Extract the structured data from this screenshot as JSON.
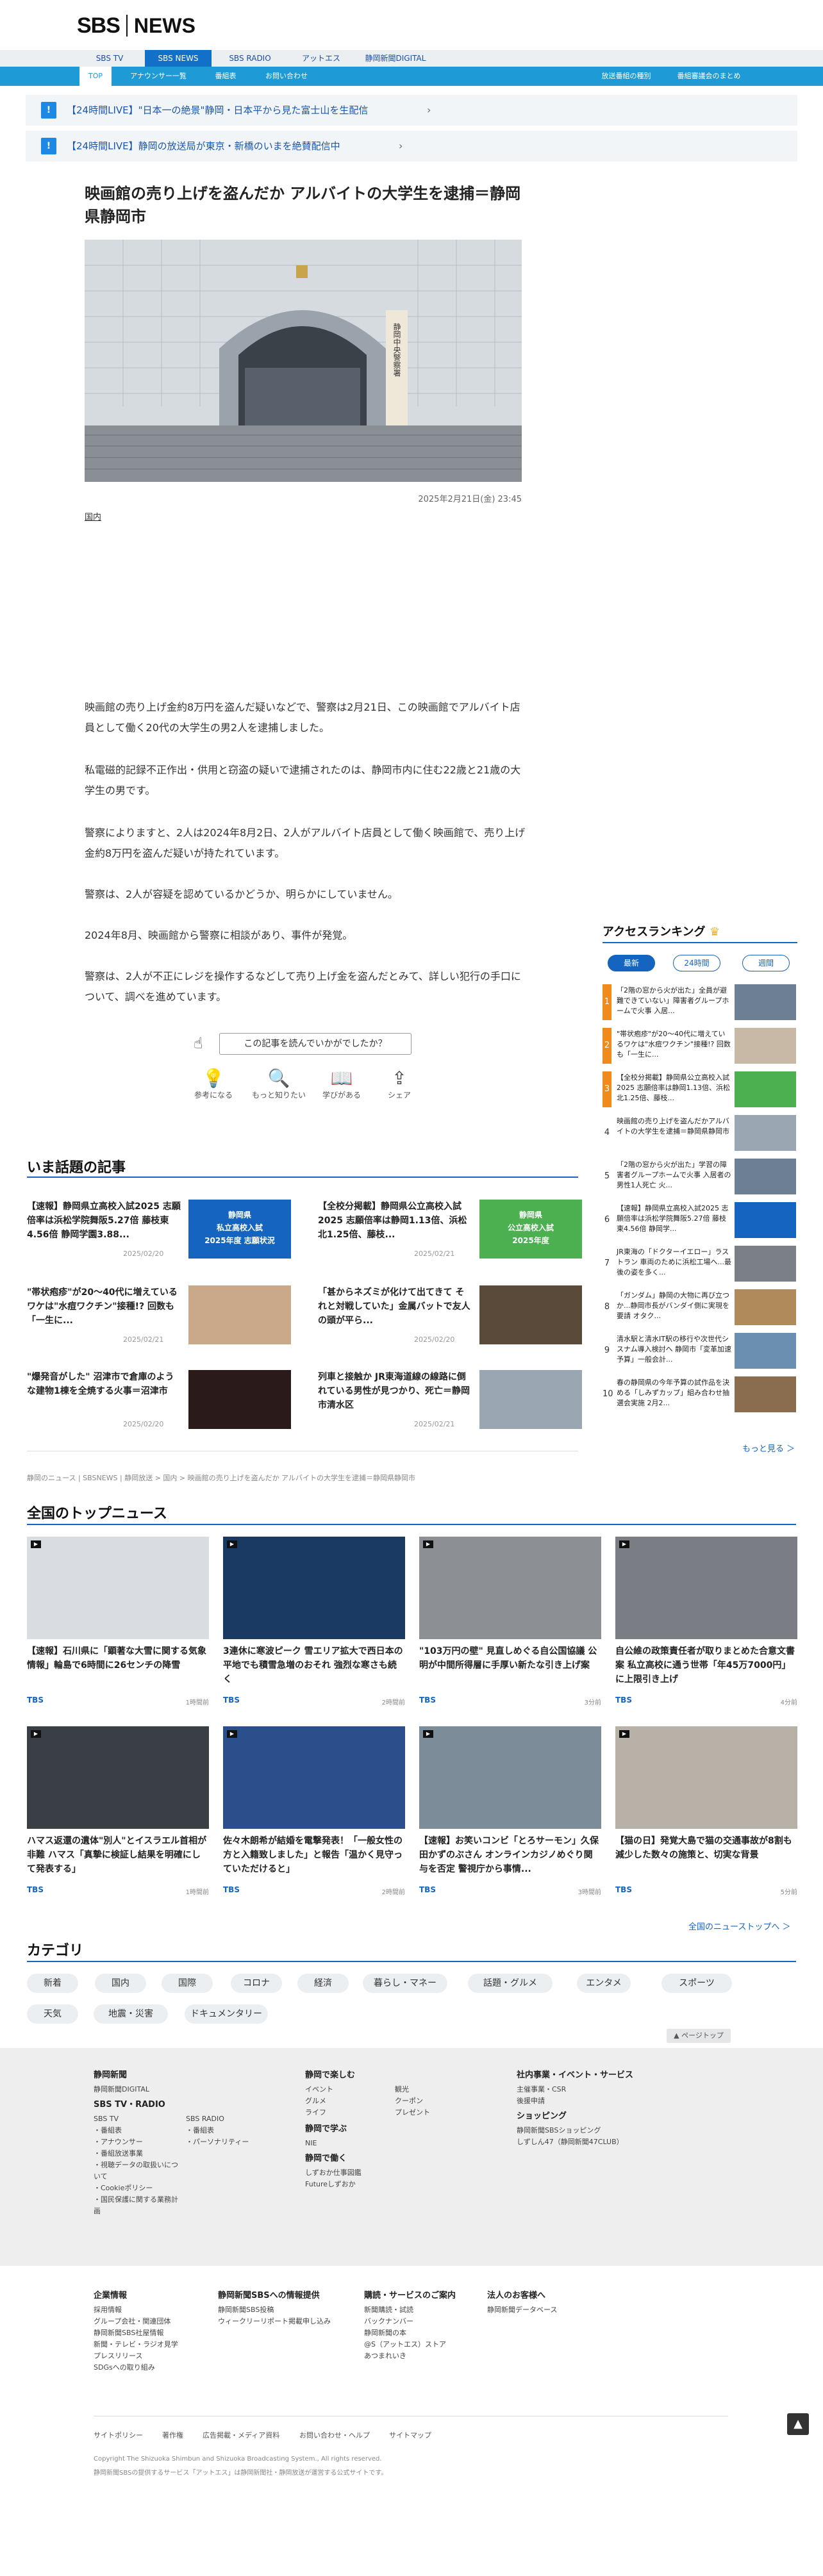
{
  "header": {
    "logo_sbs": "SBS",
    "logo_news": "NEWS",
    "nav1": [
      "SBS TV",
      "SBS NEWS",
      "SBS RADIO",
      "アットエス",
      "静岡新聞DIGITAL"
    ],
    "nav2_left": [
      "TOP",
      "アナウンサー一覧",
      "番組表",
      "お問い合わせ"
    ],
    "nav2_right": [
      "放送番組の種別",
      "番組審議会のまとめ"
    ]
  },
  "live_banners": [
    {
      "icon": "!",
      "text": "【24時間LIVE】\"日本一の絶景\"静岡・日本平から見た富士山を生配信"
    },
    {
      "icon": "!",
      "text": "【24時間LIVE】静岡の放送局が東京・新橋のいまを絶賛配信中"
    }
  ],
  "article": {
    "title": "映画館の売り上げを盗んだか アルバイトの大学生を逮捕＝静岡県静岡市",
    "photo_text": "静岡中央警察署",
    "date": "2025年2月21日(金) 23:45",
    "tag": "国内",
    "paragraphs": [
      "映画館の売り上げ金約8万円を盗んだ疑いなどで、警察は2月21日、この映画館でアルバイト店員として働く20代の大学生の男2人を逮捕しました。",
      "私電磁的記録不正作出・供用と窃盗の疑いで逮捕されたのは、静岡市内に住む22歳と21歳の大学生の男です。",
      "警察によりますと、2人は2024年8月2日、2人がアルバイト店員として働く映画館で、売り上げ金約8万円を盗んだ疑いが持たれています。",
      "警察は、2人が容疑を認めているかどうか、明らかにしていません。",
      "2024年8月、映画館から警察に相談があり、事件が発覚。",
      "警察は、2人が不正にレジを操作するなどして売り上げ金を盗んだとみて、詳しい犯行の手口について、調べを進めています。"
    ],
    "feedback_question": "この記事を読んでいかがでしたか？",
    "reactions": [
      "参考になる",
      "もっと知りたい",
      "学びがある",
      "シェア"
    ]
  },
  "hot_topics": {
    "heading": "いま話題の記事",
    "items": [
      {
        "title": "【速報】静岡県立高校入試2025 志願倍率は浜松学院舞阪5.27倍 藤枝東4.56倍 静岡学園3.88...",
        "date": "2025/02/20",
        "img_label": "静岡県\n私立高校入試\n2025年度 志願状況"
      },
      {
        "title": "【全校分掲載】静岡県公立高校入試2025 志願倍率は静岡1.13倍、浜松北1.25倍、藤枝...",
        "date": "2025/02/21",
        "img_label": "静岡県\n公立高校入試\n2025年度"
      },
      {
        "title": "\"帯状疱疹\"が20〜40代に増えているワケは\"水痘ワクチン\"接種!? 回数も「一生に...",
        "date": "2025/02/21",
        "img_label": ""
      },
      {
        "title": "「甚からネズミが化けて出てきて それと対戦していた」金属バットで友人の頭が平ら...",
        "date": "2025/02/20",
        "img_label": ""
      },
      {
        "title": "\"爆発音がした\" 沼津市で倉庫のような建物1棟を全焼する火事＝沼津市",
        "date": "2025/02/20",
        "img_label": ""
      },
      {
        "title": "列車と接触か JR東海道線の線路に倒れている男性が見つかり、死亡＝静岡市清水区",
        "date": "2025/02/21",
        "img_label": ""
      }
    ]
  },
  "breadcrumb": "静岡のニュース | SBSNEWS | 静岡放送 > 国内 > 映画館の売り上げを盗んだか アルバイトの大学生を逮捕＝静岡県静岡市",
  "ranking": {
    "heading": "アクセスランキング",
    "tabs": [
      "最新",
      "24時間",
      "週間"
    ],
    "items": [
      {
        "rank": "1",
        "title": "「2階の窓から火が出た」全員が避難できていない」障害者グループホームで火事 入居..."
      },
      {
        "rank": "2",
        "title": "\"帯状疱疹\"が20〜40代に増えているワケは\"水痘ワクチン\"接種!? 回数も「一生に..."
      },
      {
        "rank": "3",
        "title": "【全校分掲載】静岡県公立高校入試2025 志願倍率は静岡1.13倍、浜松北1.25倍、藤枝..."
      },
      {
        "rank": "4",
        "title": "映画館の売り上げを盗んだかアルバイトの大学生を逮捕＝静岡県静岡市"
      },
      {
        "rank": "5",
        "title": "「2階の窓から火が出た」学習の障害者グループホームで火事 入居者の男性1人死亡 火..."
      },
      {
        "rank": "6",
        "title": "【速報】静岡県立高校入試2025 志願倍率は浜松学院舞阪5.27倍 藤枝東4.56倍 静岡学..."
      },
      {
        "rank": "7",
        "title": "JR東海の「ドクターイエロー」ラストラン 車両のために浜松工場へ...最後の姿を多く..."
      },
      {
        "rank": "8",
        "title": "「ガンダム」静岡の大物に再び立つか...静岡市長がバンダイ側に実現を要請 オタク..."
      },
      {
        "rank": "9",
        "title": "清水駅と清水IT駅の移行や次世代シスナム導入検討へ 静岡市「変革加速予算」一般会計..."
      },
      {
        "rank": "10",
        "title": "春の静岡県の今年予算の試作品を決める「しみずカップ」組み合わせ抽選会実施 2月2..."
      }
    ],
    "more": "もっと見る ＞"
  },
  "top_news": {
    "heading": "全国のトップニュース",
    "items": [
      {
        "title": "【速報】石川県に「顕著な大雪に関する気象情報」輪島で6時間に26センチの降雪",
        "source": "TBS",
        "ago": "1時間前"
      },
      {
        "title": "3連休に寒波ピーク 雪エリア拡大で西日本の平地でも積雪急増のおそれ 強烈な寒さも続く",
        "source": "TBS",
        "ago": "2時間前"
      },
      {
        "title": "\"103万円の壁\" 見直しめぐる自公国協議 公明が中間所得層に手厚い新たな引き上げ案",
        "source": "TBS",
        "ago": "3分前"
      },
      {
        "title": "自公維の政策責任者が取りまとめた合意文書案 私立高校に通う世帯「年45万7000円」に上限引き上げ",
        "source": "TBS",
        "ago": "4分前"
      },
      {
        "title": "ハマス返還の遺体\"別人\"とイスラエル首相が非難 ハマス「真摯に検証し結果を明確にして発表する」",
        "source": "TBS",
        "ago": "1時間前"
      },
      {
        "title": "佐々木朗希が結婚を電撃発表！「一般女性の方と入籍致しました」と報告「温かく見守っていただけると」",
        "source": "TBS",
        "ago": "2時間前"
      },
      {
        "title": "【速報】お笑いコンビ「とろサーモン」久保田かずのぶさん オンラインカジノめぐり関与を否定 警視庁から事情...",
        "source": "TBS",
        "ago": "3時間前"
      },
      {
        "title": "【猫の日】発覚大島で猫の交通事故が8割も減少した数々の施策と、切実な背景",
        "source": "TBS",
        "ago": "5分前"
      }
    ],
    "more": "全国のニューストップへ ＞"
  },
  "categories": {
    "heading": "カテゴリ",
    "items": [
      "新着",
      "国内",
      "国際",
      "コロナ",
      "経済",
      "暮らし・マネー",
      "話題・グルメ",
      "エンタメ",
      "スポーツ",
      "天気",
      "地震・災害",
      "ドキュメンタリー"
    ]
  },
  "page_top": "▲ ページトップ",
  "footer": {
    "col1": {
      "h1": "静岡新聞",
      "l1": [
        "静岡新聞DIGITAL"
      ],
      "h2": "SBS TV・RADIO",
      "tv": [
        "SBS TV",
        "・番組表",
        "・アナウンサー",
        "・番組放送事業",
        "・視聴データの取扱いについて",
        "・Cookieポリシー",
        "・国民保護に関する業務計画"
      ],
      "radio": [
        "SBS RADIO",
        "・番組表",
        "・パーソナリティー"
      ]
    },
    "col2": {
      "h1": "静岡で楽しむ",
      "l1a": [
        "イベント",
        "グルメ",
        "ライフ"
      ],
      "l1b": [
        "観光",
        "クーポン",
        "プレゼント"
      ],
      "h2": "静岡で学ぶ",
      "l2": [
        "NIE"
      ],
      "h3": "静岡で働く",
      "l3": [
        "しずおか仕事図鑑",
        "Futureしずおか"
      ]
    },
    "col3": {
      "h1": "社内事業・イベント・サービス",
      "l1": [
        "主催事業・CSR",
        "後援申請"
      ],
      "h2": "ショッピング",
      "l2": [
        "静岡新聞SBSショッピング",
        "しずしん47（静岡新聞47CLUB）"
      ]
    },
    "row2": [
      {
        "h": "企業情報",
        "l": [
          "採用情報",
          "グループ会社・関連団体",
          "静岡新聞SBS社屋情報",
          "新聞・テレビ・ラジオ見学",
          "プレスリリース",
          "SDGsへの取り組み"
        ]
      },
      {
        "h": "静岡新聞SBSへの情報提供",
        "l": [
          "静岡新聞SBS投稿",
          "ウィークリーリポート掲載申し込み"
        ]
      },
      {
        "h": "購読・サービスのご案内",
        "l": [
          "新聞購読・試読",
          "バックナンバー",
          "静岡新聞の本",
          "@S（アットエス）ストア",
          "あつまれいき"
        ]
      },
      {
        "h": "法人のお客様へ",
        "l": [
          "静岡新聞データベース"
        ]
      }
    ],
    "bottom_links": [
      "サイトポリシー",
      "著作権",
      "広告掲載・メディア資料",
      "お問い合わせ・ヘルプ",
      "サイトマップ"
    ],
    "copyright": "Copyright The Shizuoka Shimbun and Shizuoka Broadcasting System., All rights reserved.",
    "note": "静岡新聞SBSの提供するサービス「アットエス」は静岡新聞社・静岡放送が運営する公式サイトです。"
  },
  "colors": {
    "accent": "#1565c0",
    "nav_blue": "#1e9ad6",
    "rank_orange": "#f08a1c"
  }
}
